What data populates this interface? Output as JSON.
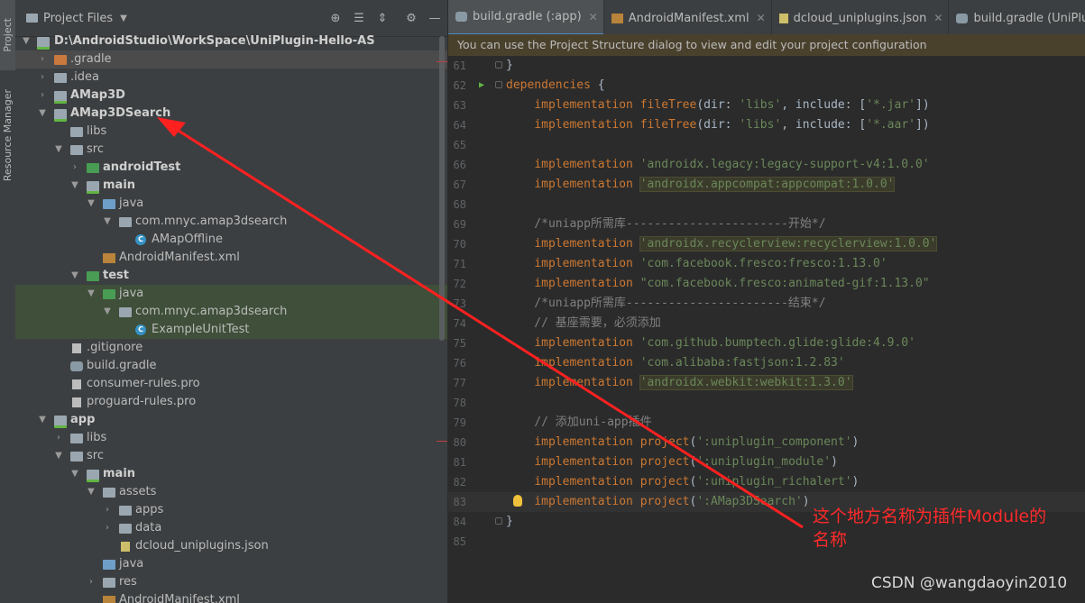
{
  "toolstrip": {
    "project_tab": "Project",
    "resource_tab": "Resource Manager"
  },
  "project_panel": {
    "title": "Project Files",
    "header_icons": [
      "target-icon",
      "collapse-all-icon",
      "expand-all-icon",
      "gear-icon",
      "minimize-icon"
    ],
    "tree": [
      {
        "label": "D:\\AndroidStudio\\WorkSpace\\UniPlugin-Hello-AS",
        "bold": true
      },
      {
        "label": ".gradle"
      },
      {
        "label": ".idea"
      },
      {
        "label": "AMap3D",
        "bold": true
      },
      {
        "label": "AMap3DSearch",
        "bold": true
      },
      {
        "label": "libs"
      },
      {
        "label": "src"
      },
      {
        "label": "androidTest",
        "bold": true
      },
      {
        "label": "main",
        "bold": true
      },
      {
        "label": "java"
      },
      {
        "label": "com.mnyc.amap3dsearch"
      },
      {
        "label": "AMapOffline"
      },
      {
        "label": "AndroidManifest.xml"
      },
      {
        "label": "test",
        "bold": true
      },
      {
        "label": "java"
      },
      {
        "label": "com.mnyc.amap3dsearch"
      },
      {
        "label": "ExampleUnitTest"
      },
      {
        "label": ".gitignore"
      },
      {
        "label": "build.gradle"
      },
      {
        "label": "consumer-rules.pro"
      },
      {
        "label": "proguard-rules.pro"
      },
      {
        "label": "app",
        "bold": true
      },
      {
        "label": "libs"
      },
      {
        "label": "src"
      },
      {
        "label": "main",
        "bold": true
      },
      {
        "label": "assets"
      },
      {
        "label": "apps"
      },
      {
        "label": "data"
      },
      {
        "label": "dcloud_uniplugins.json"
      },
      {
        "label": "java"
      },
      {
        "label": "res"
      },
      {
        "label": "AndroidManifest.xml"
      }
    ]
  },
  "editor": {
    "tabs": [
      {
        "label": "build.gradle (:app)",
        "active": true
      },
      {
        "label": "AndroidManifest.xml"
      },
      {
        "label": "dcloud_uniplugins.json"
      },
      {
        "label": "build.gradle (UniPlugin-Hello-"
      }
    ],
    "banner": "You can use the Project Structure dialog to view and edit your project configuration",
    "lines": [
      {
        "n": "61",
        "t": "}"
      },
      {
        "n": "62",
        "t": "dependencies {"
      },
      {
        "n": "63",
        "t": "    implementation fileTree(dir: 'libs', include: ['*.jar'])"
      },
      {
        "n": "64",
        "t": "    implementation fileTree(dir: 'libs', include: ['*.aar'])"
      },
      {
        "n": "65",
        "t": ""
      },
      {
        "n": "66",
        "t": "    implementation 'androidx.legacy:legacy-support-v4:1.0.0'"
      },
      {
        "n": "67",
        "t": "    implementation 'androidx.appcompat:appcompat:1.0.0'"
      },
      {
        "n": "68",
        "t": ""
      },
      {
        "n": "69",
        "t": "    /*uniapp所需库-----------------------开始*/"
      },
      {
        "n": "70",
        "t": "    implementation 'androidx.recyclerview:recyclerview:1.0.0'"
      },
      {
        "n": "71",
        "t": "    implementation 'com.facebook.fresco:fresco:1.13.0'"
      },
      {
        "n": "72",
        "t": "    implementation \"com.facebook.fresco:animated-gif:1.13.0\""
      },
      {
        "n": "73",
        "t": "    /*uniapp所需库-----------------------结束*/"
      },
      {
        "n": "74",
        "t": "    // 基座需要，必须添加"
      },
      {
        "n": "75",
        "t": "    implementation 'com.github.bumptech.glide:glide:4.9.0'"
      },
      {
        "n": "76",
        "t": "    implementation 'com.alibaba:fastjson:1.2.83'"
      },
      {
        "n": "77",
        "t": "    implementation 'androidx.webkit:webkit:1.3.0'"
      },
      {
        "n": "78",
        "t": ""
      },
      {
        "n": "79",
        "t": "    // 添加uni-app插件"
      },
      {
        "n": "80",
        "t": "    implementation project(':uniplugin_component')"
      },
      {
        "n": "81",
        "t": "    implementation project(':uniplugin_module')"
      },
      {
        "n": "82",
        "t": "    implementation project(':uniplugin_richalert')"
      },
      {
        "n": "83",
        "t": "    implementation project(':AMap3DSearch')"
      },
      {
        "n": "84",
        "t": "}"
      },
      {
        "n": "85",
        "t": ""
      }
    ]
  },
  "annotation": {
    "line1": "这个地方名称为插件Module的",
    "line2": "名称",
    "color": "#ff2a2a"
  },
  "watermark": "CSDN @wangdaoyin2010"
}
